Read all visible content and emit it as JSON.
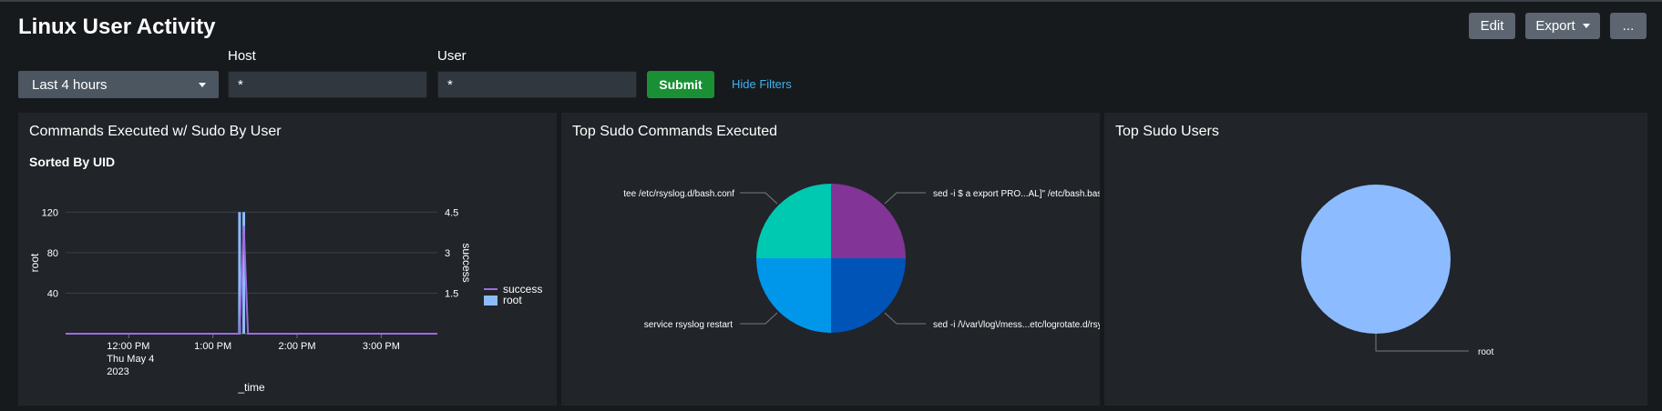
{
  "header": {
    "title": "Linux User Activity",
    "edit_label": "Edit",
    "export_label": "Export",
    "more_label": "..."
  },
  "filters": {
    "time_value": "Last 4 hours",
    "host_label": "Host",
    "host_value": "*",
    "user_label": "User",
    "user_value": "*",
    "submit_label": "Submit",
    "hide_filters_label": "Hide Filters"
  },
  "panels": {
    "commands_by_user": {
      "title": "Commands Executed w/ Sudo By User",
      "subtitle": "Sorted By UID"
    },
    "top_commands": {
      "title": "Top Sudo Commands Executed"
    },
    "top_users": {
      "title": "Top Sudo Users"
    }
  },
  "chart_data": [
    {
      "type": "line",
      "x_tick_labels": [
        [
          "12:00 PM",
          "Thu May 4",
          "2023"
        ],
        [
          "1:00 PM"
        ],
        [
          "2:00 PM"
        ],
        [
          "3:00 PM"
        ]
      ],
      "xlabel": "_time",
      "ylabel": "root",
      "y2label": "success",
      "ylim": [
        0,
        140
      ],
      "y_ticks": [
        40,
        80,
        120
      ],
      "y2lim": [
        0,
        5.25
      ],
      "y2_ticks": [
        1.5,
        3,
        4.5
      ],
      "grid": true,
      "legend": "right",
      "series": [
        {
          "name": "success",
          "axis": "y2",
          "chart": "line",
          "color": "#9b6dde",
          "x": [
            "11:15",
            "13:13",
            "13:19",
            "13:22",
            "13:25",
            "13:31",
            "15:40"
          ],
          "values": [
            0,
            0,
            0,
            4,
            0,
            0,
            0
          ]
        },
        {
          "name": "root",
          "axis": "y",
          "chart": "column",
          "color": "#8cbcff",
          "x": [
            "13:19",
            "13:22"
          ],
          "values": [
            120,
            120
          ]
        }
      ]
    },
    {
      "type": "pie",
      "slices": [
        {
          "label": "sed -i $ a export PRO...AL]\" /etc/bash.bashrc",
          "value": 1,
          "color": "#833497"
        },
        {
          "label": "sed -i /\\/var\\/log\\/mess...etc/logrotate.d/rsyslog",
          "value": 1,
          "color": "#0054b8"
        },
        {
          "label": "service rsyslog restart",
          "value": 1,
          "color": "#0096ea"
        },
        {
          "label": "tee /etc/rsyslog.d/bash.conf",
          "value": 1,
          "color": "#00c9b1"
        }
      ]
    },
    {
      "type": "pie",
      "slices": [
        {
          "label": "root",
          "value": 1,
          "color": "#8cbcff"
        }
      ]
    }
  ]
}
